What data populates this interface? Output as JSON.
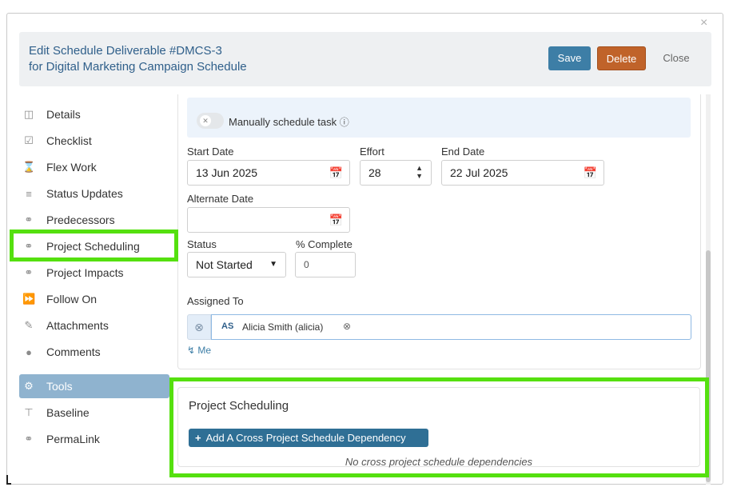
{
  "dialog": {
    "close_glyph": "×",
    "title_line1": "Edit Schedule Deliverable #DMCS-3",
    "title_line2": "for Digital Marketing Campaign Schedule",
    "save_label": "Save",
    "delete_label": "Delete",
    "close_label": "Close"
  },
  "sidebar": {
    "items": [
      {
        "label": "Details",
        "icon": "document-icon"
      },
      {
        "label": "Checklist",
        "icon": "checkbox-icon"
      },
      {
        "label": "Flex Work",
        "icon": "hourglass-icon"
      },
      {
        "label": "Status Updates",
        "icon": "list-icon"
      },
      {
        "label": "Predecessors",
        "icon": "link-icon"
      },
      {
        "label": "Project Scheduling",
        "icon": "link-icon"
      },
      {
        "label": "Project Impacts",
        "icon": "link-icon"
      },
      {
        "label": "Follow On",
        "icon": "fast-forward-icon"
      },
      {
        "label": "Attachments",
        "icon": "paperclip-icon"
      },
      {
        "label": "Comments",
        "icon": "comments-icon"
      }
    ],
    "tools": [
      {
        "label": "Tools",
        "icon": "gear-icon"
      },
      {
        "label": "Baseline",
        "icon": "baseline-icon"
      },
      {
        "label": "PermaLink",
        "icon": "link-icon"
      }
    ]
  },
  "form": {
    "manual_label": "Manually schedule task",
    "start_date_label": "Start Date",
    "start_date_value": "13 Jun 2025",
    "effort_label": "Effort",
    "effort_value": "28",
    "end_date_label": "End Date",
    "end_date_value": "22 Jul 2025",
    "alternate_date_label": "Alternate Date",
    "alternate_date_value": "",
    "status_label": "Status",
    "status_value": "Not Started",
    "percent_label": "% Complete",
    "percent_value": "0",
    "assigned_label": "Assigned To",
    "assignee_initials": "AS",
    "assignee_name": "Alicia Smith (alicia)",
    "me_link": "Me"
  },
  "project_scheduling": {
    "title": "Project Scheduling",
    "add_button": "Add A Cross Project Schedule Dependency",
    "empty_text": "No cross project schedule dependencies"
  }
}
